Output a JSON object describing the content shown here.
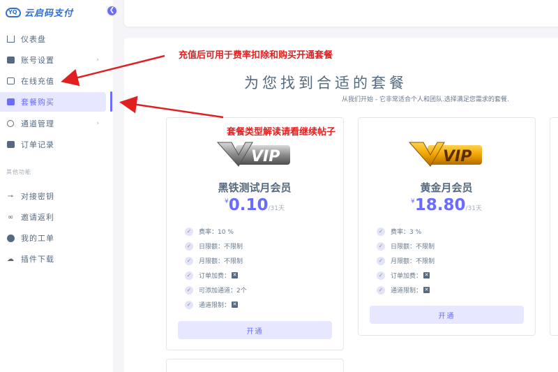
{
  "app": {
    "logo_text": "云启码支付",
    "logo_mark": "YQ"
  },
  "sidebar": {
    "items": [
      {
        "label": "仪表盘",
        "icon": "home-icon"
      },
      {
        "label": "账号设置",
        "icon": "user-card-icon",
        "chevron": "›"
      },
      {
        "label": "在线充值",
        "icon": "money-icon"
      },
      {
        "label": "套餐购买",
        "icon": "package-icon",
        "active": true
      },
      {
        "label": "通道管理",
        "icon": "gear-icon",
        "chevron": "›"
      },
      {
        "label": "订单记录",
        "icon": "wallet-icon"
      }
    ],
    "section_header": "其他功能",
    "other_items": [
      {
        "label": "对接密钥",
        "icon": "key-icon"
      },
      {
        "label": "邀请返利",
        "icon": "link-icon"
      },
      {
        "label": "我的工单",
        "icon": "chat-icon"
      },
      {
        "label": "插件下载",
        "icon": "cloud-download-icon"
      }
    ]
  },
  "main": {
    "heading": "为您找到合适的套餐",
    "subheading": "从我们开始 - 它非常适合个人和团队.选择满足您需求的套餐.",
    "plans": [
      {
        "badge": "VIP",
        "title": "黑铁测试月会员",
        "currency": "¥",
        "price": "0.10",
        "period": "/31天",
        "features": [
          {
            "text": "费率：10 %"
          },
          {
            "text": "日限额：不限制"
          },
          {
            "text": "月限额：不限制"
          },
          {
            "text": "订单加费：",
            "x": "✕"
          },
          {
            "text": "可添加通道：2个"
          },
          {
            "text": "通道限制：",
            "x": "✕"
          }
        ],
        "button": "开通"
      },
      {
        "badge": "VIP",
        "title": "黄金月会员",
        "currency": "¥",
        "price": "18.80",
        "period": "/31天",
        "features": [
          {
            "text": "费率：3 %"
          },
          {
            "text": "日限额：不限制"
          },
          {
            "text": "月限额：不限制"
          },
          {
            "text": "订单加费：",
            "x": "✕"
          },
          {
            "text": "通道限制：",
            "x": "✕"
          }
        ],
        "button": "开通"
      }
    ]
  },
  "annotations": {
    "recharge_note": "充值后可用于费率扣除和购买开通套餐",
    "package_note": "套餐类型解读请看继续帖子"
  },
  "colors": {
    "accent": "#696cff",
    "annotation": "#e02020",
    "logo": "#2f6fd6"
  }
}
